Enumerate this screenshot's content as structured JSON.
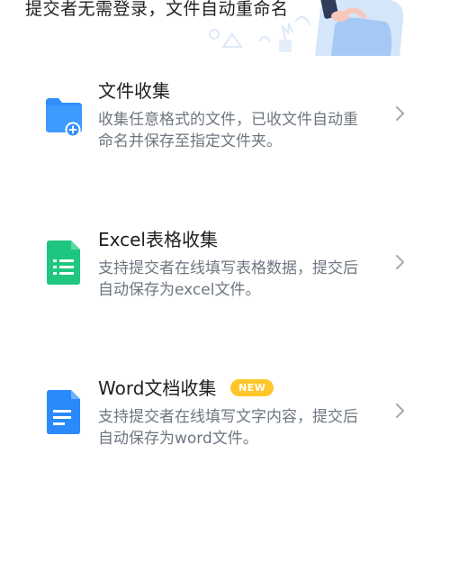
{
  "header": {
    "subtitle": "提交者无需登录，文件自动重命名"
  },
  "cards": [
    {
      "title": "文件收集",
      "description": "收集任意格式的文件，已收文件自动重命名并保存至指定文件夹。",
      "icon": "folder-add-icon",
      "color": "#2f8ffb"
    },
    {
      "title": "Excel表格收集",
      "description": "支持提交者在线填写表格数据，提交后自动保存为excel文件。",
      "icon": "excel-sheet-icon",
      "color": "#1fc67f"
    },
    {
      "title": "Word文档收集",
      "description": "支持提交者在线填写文字内容，提交后自动保存为word文件。",
      "icon": "word-doc-icon",
      "color": "#2a8afb",
      "badge": "NEW"
    }
  ],
  "colors": {
    "badge": "#ffc62a",
    "description_text": "#6e7680",
    "chevron": "#a4a9b0"
  }
}
